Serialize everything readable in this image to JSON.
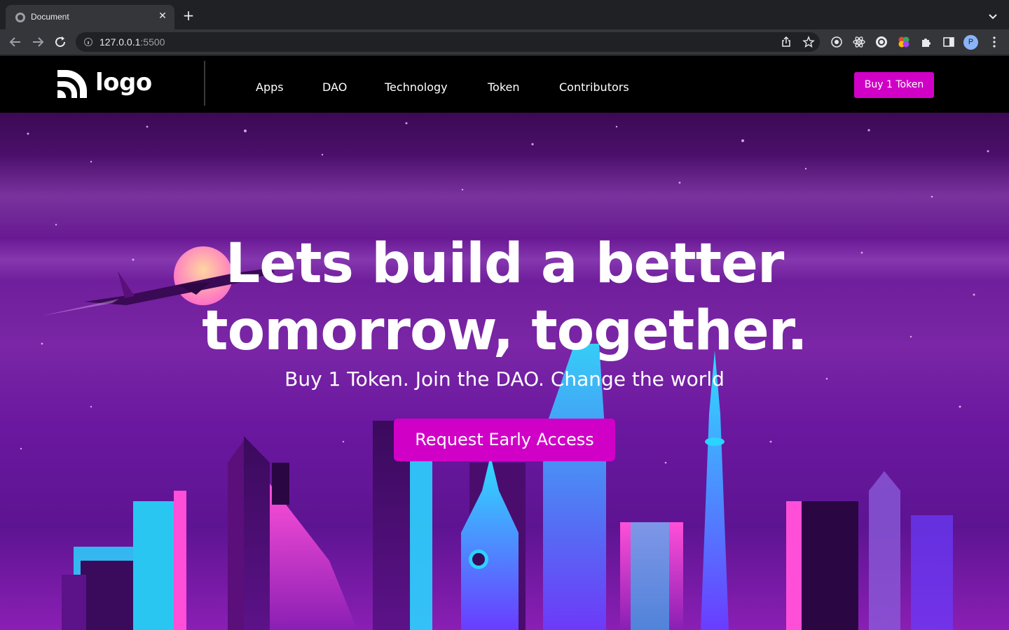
{
  "browser": {
    "tab_title": "Document",
    "url_host": "127.0.0.1",
    "url_port": ":5500",
    "profile_initial": "P"
  },
  "site": {
    "logo_text": "logo",
    "nav_links": [
      "Apps",
      "DAO",
      "Technology",
      "Token",
      "Contributors"
    ],
    "buy_button": "Buy 1 Token"
  },
  "hero": {
    "headline_line1": "Lets build a better",
    "headline_line2": "tomorrow, together.",
    "subline": "Buy 1 Token. Join the DAO. Change the world",
    "cta": "Request Early Access"
  },
  "colors": {
    "accent": "#d100c7",
    "navbar_bg": "#000000",
    "chrome_bg": "#202124"
  }
}
